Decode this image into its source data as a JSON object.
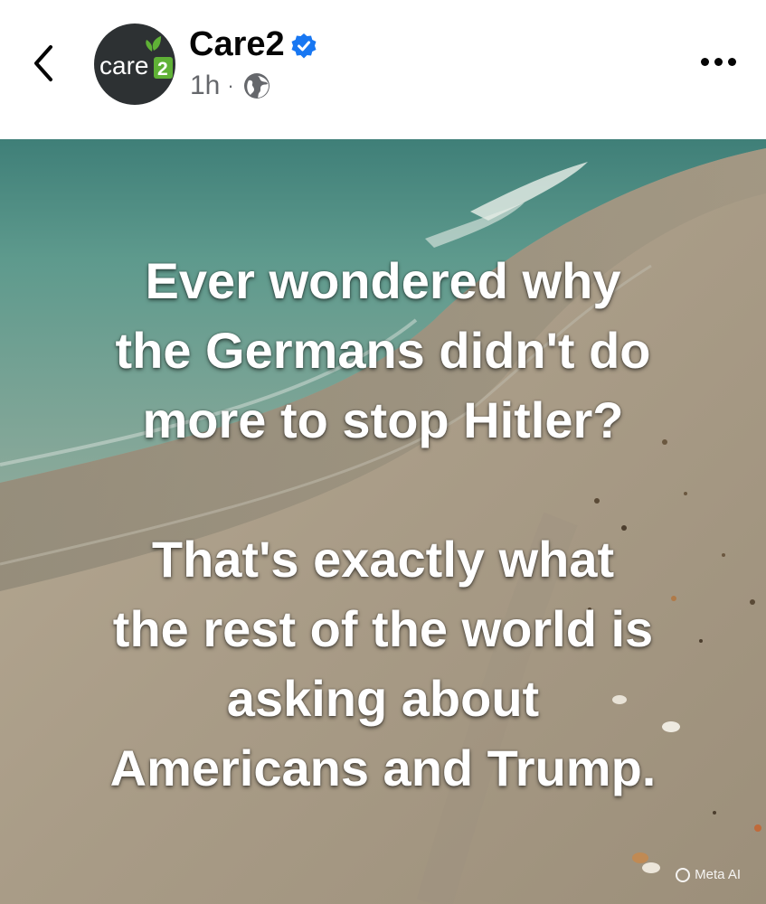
{
  "post": {
    "author": "Care2",
    "avatar_text": "care",
    "avatar_badge": "2",
    "timestamp": "1h",
    "separator": "·",
    "privacy_icon": "globe-icon",
    "verified_icon": "verified-badge-icon",
    "more_icon": "more-dots-icon",
    "back_icon": "chevron-left-icon"
  },
  "image": {
    "paragraph_1": "Ever wondered why\nthe Germans didn't do\nmore to stop Hitler?",
    "paragraph_2": "That's exactly what\nthe rest of the world is\nasking about\nAmericans and Trump.",
    "watermark": "Meta AI"
  },
  "colors": {
    "verified": "#1877f2",
    "avatar_bg": "#2d3133",
    "brand_green": "#5fb136",
    "text_primary": "#050505",
    "text_secondary": "#65676b"
  }
}
